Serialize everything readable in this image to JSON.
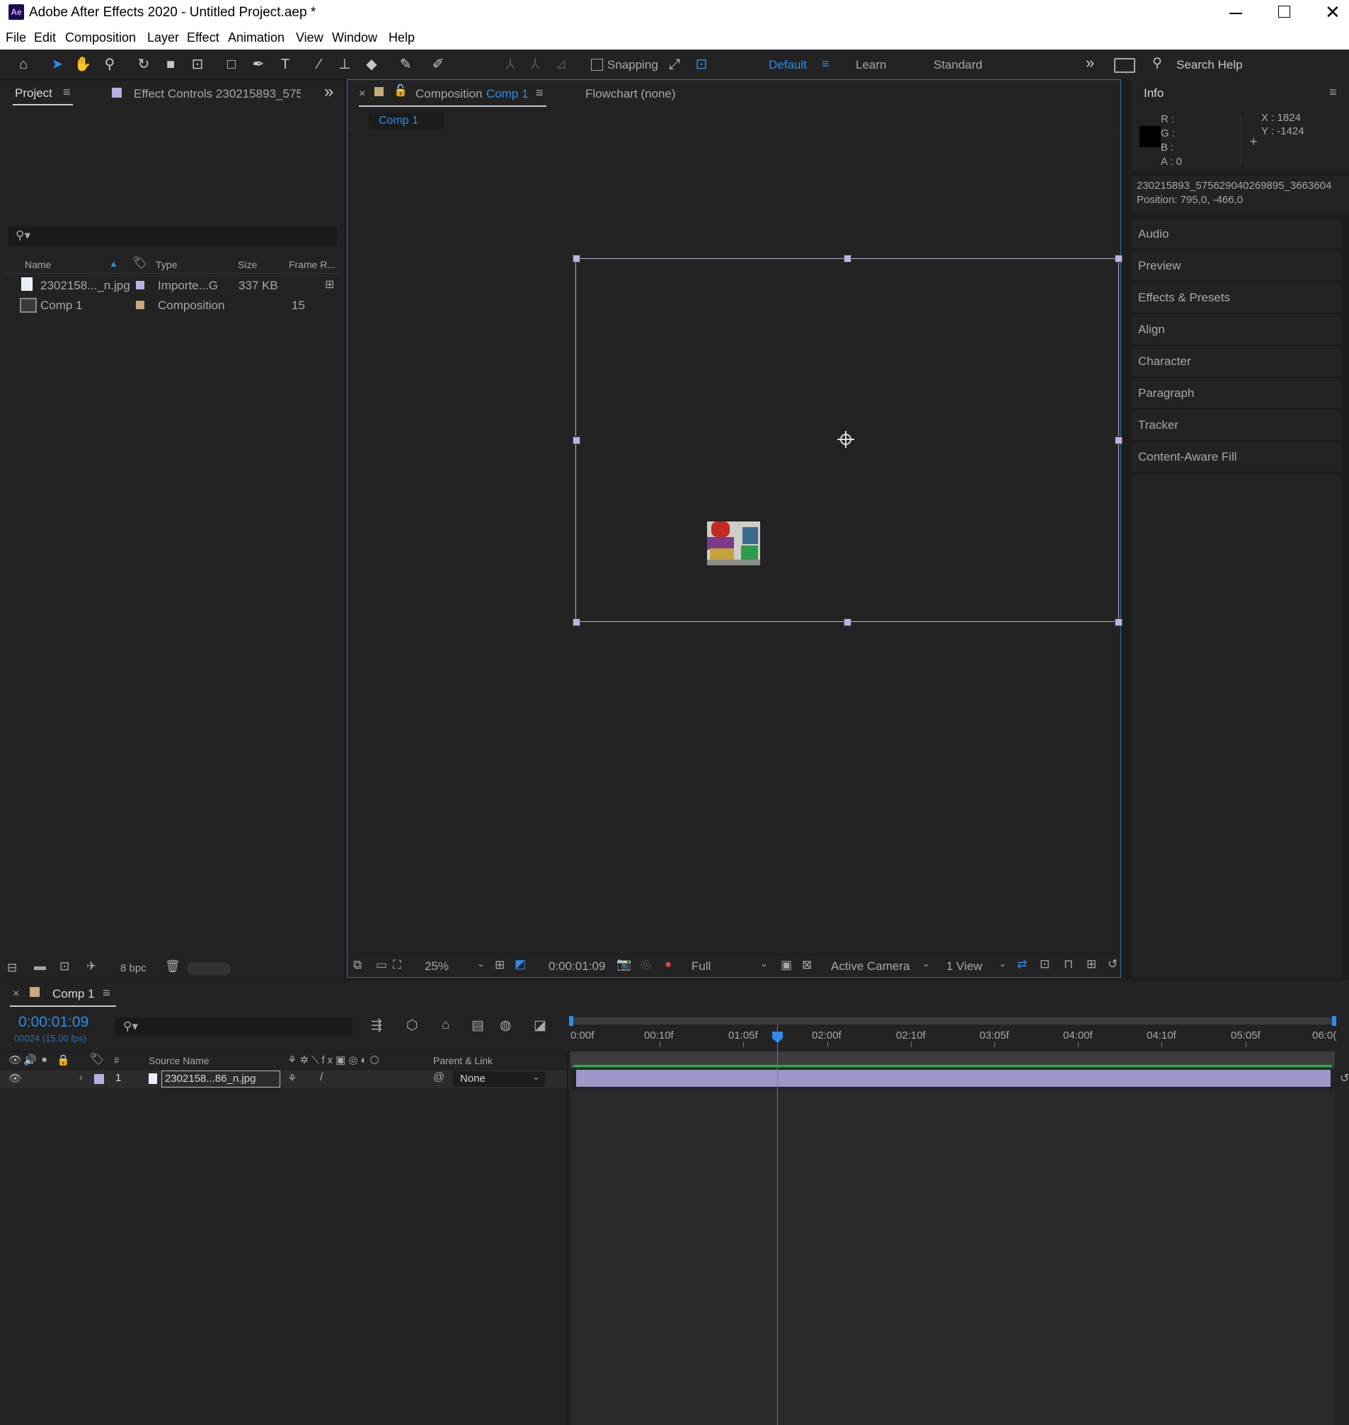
{
  "window": {
    "title": "Adobe After Effects 2020 - Untitled Project.aep *",
    "app_icon": "Ae",
    "controls": [
      "minimize-icon",
      "maximize-icon",
      "close-icon"
    ]
  },
  "menu": [
    "File",
    "Edit",
    "Composition",
    "Layer",
    "Effect",
    "Animation",
    "View",
    "Window",
    "Help"
  ],
  "toolbar": {
    "snapping_label": "Snapping",
    "workspaces": [
      "Default",
      "Learn",
      "Standard"
    ],
    "active_workspace": "Default",
    "search_placeholder": "Search Help"
  },
  "project_panel": {
    "tab_project": "Project",
    "tab_effect_controls": "Effect Controls 230215893_575",
    "columns": [
      "Name",
      "Type",
      "Size",
      "Frame R..."
    ],
    "items": [
      {
        "name": "2302158..._n.jpg",
        "type": "Importe...G",
        "size": "337 KB",
        "frame_rate": ""
      },
      {
        "name": "Comp 1",
        "type": "Composition",
        "size": "",
        "frame_rate": "15"
      }
    ],
    "bpc": "8 bpc"
  },
  "composition_panel": {
    "tab_prefix": "Composition",
    "tab_name": "Comp 1",
    "flowchart": "Flowchart (none)",
    "breadcrumb": "Comp 1",
    "zoom": "25%",
    "timecode": "0:00:01:09",
    "resolution": "Full",
    "camera": "Active Camera",
    "views": "1 View"
  },
  "info_panel": {
    "title": "Info",
    "r": "R :",
    "g": "G :",
    "b": "B :",
    "a": "A :  0",
    "x": "X : 1824",
    "y": "Y : -1424",
    "layer_name": "230215893_575629040269895_3663604",
    "position": "Position: 795,0, -466,0",
    "sections": [
      "Audio",
      "Preview",
      "Effects & Presets",
      "Align",
      "Character",
      "Paragraph",
      "Tracker",
      "Content-Aware Fill"
    ]
  },
  "timeline": {
    "tab_name": "Comp 1",
    "timecode": "0:00:01:09",
    "frame_info": "00024 (15.00 fps)",
    "col_num": "#",
    "col_source": "Source Name",
    "col_parent": "Parent & Link",
    "layer": {
      "index": "1",
      "name": "2302158...86_n.jpg",
      "parent": "None"
    },
    "ruler": [
      "0:00f",
      "00:10f",
      "01:05f",
      "02:00f",
      "02:10f",
      "03:05f",
      "04:00f",
      "04:10f",
      "05:05f",
      "06:0("
    ]
  },
  "colors": {
    "accent": "#2d8ceb",
    "panel": "#232323",
    "layer_bar": "#9e97c9",
    "label_lavender": "#b7b0e0",
    "label_tan": "#c8a97a"
  }
}
